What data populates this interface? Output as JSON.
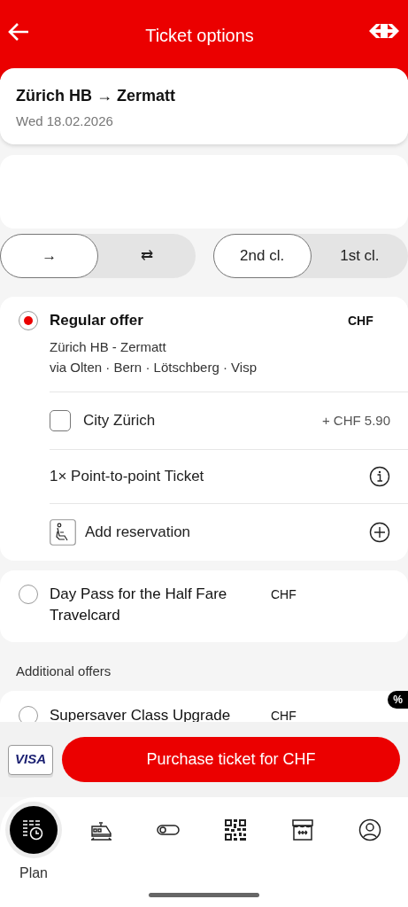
{
  "header": {
    "title": "Ticket options"
  },
  "journey": {
    "route": "Zürich HB → Zermatt",
    "date": "Wed 18.02.2026"
  },
  "trip_type": [
    {
      "label": "→",
      "selected": true
    },
    {
      "label": "⇄",
      "selected": false
    }
  ],
  "travel_class": [
    {
      "label": "2nd cl.",
      "selected": true
    },
    {
      "label": "1st cl.",
      "selected": false
    }
  ],
  "offers": [
    {
      "title": "Regular offer",
      "selected": true,
      "price": "CHF",
      "details": [
        "Zürich HB - Zermatt",
        "via Olten · Bern · Lötschberg · Visp"
      ],
      "options": [
        {
          "kind": "checkbox",
          "label": "City Zürich",
          "checked": false,
          "price": "+ CHF 5.90"
        },
        {
          "kind": "info",
          "label": "1× Point-to-point Ticket"
        },
        {
          "kind": "reservation",
          "label": "Add reservation"
        }
      ]
    },
    {
      "title": "Day Pass for the Half Fare Travelcard",
      "selected": false,
      "price": "CHF"
    }
  ],
  "additional_heading": "Additional offers",
  "additional_offers": [
    {
      "title": "Supersaver Class Upgrade",
      "selected": false,
      "price": "CHF",
      "badge": "%"
    }
  ],
  "purchase": {
    "payment": "VISA",
    "button": "Purchase ticket for CHF"
  },
  "tab_bar": [
    {
      "kind": "plan",
      "label": "Plan",
      "selected": true
    },
    {
      "kind": "train",
      "selected": false
    },
    {
      "kind": "toggle",
      "selected": false
    },
    {
      "kind": "qr",
      "selected": false
    },
    {
      "kind": "shop",
      "selected": false
    },
    {
      "kind": "profile",
      "selected": false
    }
  ]
}
